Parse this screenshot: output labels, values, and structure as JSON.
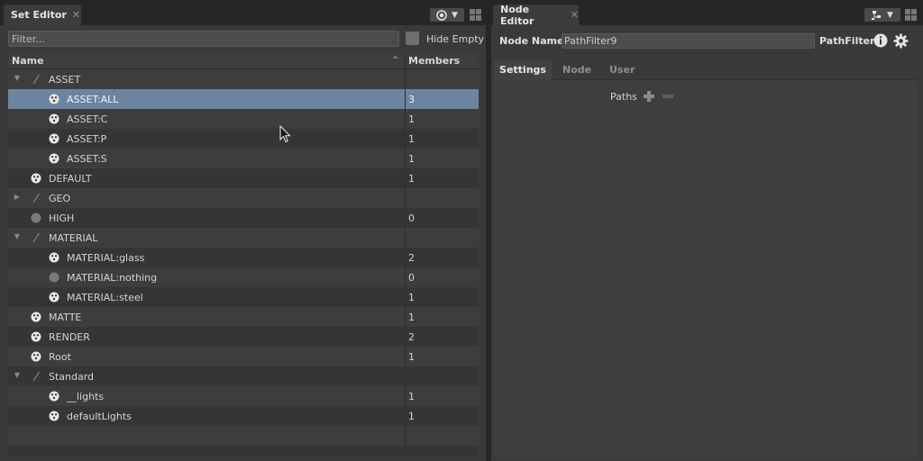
{
  "set_editor": {
    "tab_title": "Set Editor",
    "close_glyph": "✕",
    "dropdown_glyph": "▼",
    "filter_placeholder": "Filter...",
    "hide_empty_label": "Hide Empty",
    "columns": {
      "name": "Name",
      "members": "Members"
    },
    "sort_glyph": "^",
    "rows": [
      {
        "name": "ASSET",
        "members": "",
        "level": 0,
        "icon": "pencil-icon",
        "expander": "expanded"
      },
      {
        "name": "ASSET:ALL",
        "members": "3",
        "level": 1,
        "icon": "set-icon",
        "expander": "",
        "selected": true
      },
      {
        "name": "ASSET:C",
        "members": "1",
        "level": 1,
        "icon": "set-icon",
        "expander": ""
      },
      {
        "name": "ASSET:P",
        "members": "1",
        "level": 1,
        "icon": "set-icon",
        "expander": ""
      },
      {
        "name": "ASSET:S",
        "members": "1",
        "level": 1,
        "icon": "set-icon",
        "expander": ""
      },
      {
        "name": "DEFAULT",
        "members": "1",
        "level": 0,
        "icon": "set-icon",
        "expander": ""
      },
      {
        "name": "GEO",
        "members": "",
        "level": 0,
        "icon": "pencil-icon",
        "expander": "collapsed"
      },
      {
        "name": "HIGH",
        "members": "0",
        "level": 0,
        "icon": "empty-set-icon",
        "expander": ""
      },
      {
        "name": "MATERIAL",
        "members": "",
        "level": 0,
        "icon": "pencil-icon",
        "expander": "expanded"
      },
      {
        "name": "MATERIAL:glass",
        "members": "2",
        "level": 1,
        "icon": "set-icon",
        "expander": ""
      },
      {
        "name": "MATERIAL:nothing",
        "members": "0",
        "level": 1,
        "icon": "empty-set-icon",
        "expander": ""
      },
      {
        "name": "MATERIAL:steel",
        "members": "1",
        "level": 1,
        "icon": "set-icon",
        "expander": ""
      },
      {
        "name": "MATTE",
        "members": "1",
        "level": 0,
        "icon": "set-icon",
        "expander": ""
      },
      {
        "name": "RENDER",
        "members": "2",
        "level": 0,
        "icon": "set-icon",
        "expander": ""
      },
      {
        "name": "Root",
        "members": "1",
        "level": 0,
        "icon": "set-icon",
        "expander": ""
      },
      {
        "name": "Standard",
        "members": "",
        "level": 0,
        "icon": "pencil-icon",
        "expander": "expanded"
      },
      {
        "name": "__lights",
        "members": "1",
        "level": 1,
        "icon": "set-icon",
        "expander": ""
      },
      {
        "name": "defaultLights",
        "members": "1",
        "level": 1,
        "icon": "set-icon",
        "expander": ""
      },
      {
        "name": "",
        "members": "",
        "level": 0,
        "icon": "",
        "expander": ""
      },
      {
        "name": "",
        "members": "",
        "level": 0,
        "icon": "",
        "expander": ""
      }
    ]
  },
  "node_editor": {
    "tab_title": "Node Editor",
    "close_glyph": "✕",
    "dropdown_glyph": "▼",
    "node_name_label": "Node Name",
    "node_name_value": "PathFilter9",
    "node_type": "PathFilter",
    "tabs": [
      {
        "label": "Settings",
        "active": true
      },
      {
        "label": "Node",
        "active": false
      },
      {
        "label": "User",
        "active": false
      }
    ],
    "paths_label": "Paths"
  },
  "colors": {
    "selection": "#6b84a0",
    "panel": "#3a3a3a",
    "background": "#262626"
  }
}
